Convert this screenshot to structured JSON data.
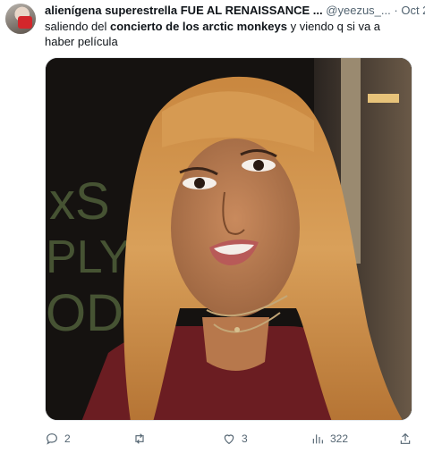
{
  "tweet": {
    "display_name": "alienígena superestrella FUE AL RENAISSANCE ...",
    "handle": "@yeezus_...",
    "separator": "·",
    "date": "Oct 2",
    "text_part1": "saliendo del ",
    "text_bold": "concierto de los arctic monkeys",
    "text_part2": " y viendo q si va a haber película"
  },
  "media": {
    "sign_text": "xS PLY ODU"
  },
  "actions": {
    "reply_icon": "reply-icon",
    "reply_count": "2",
    "retweet_icon": "retweet-icon",
    "retweet_count": "",
    "like_icon": "heart-icon",
    "like_count": "3",
    "views_icon": "views-icon",
    "views_count": "322",
    "share_icon": "share-icon"
  }
}
